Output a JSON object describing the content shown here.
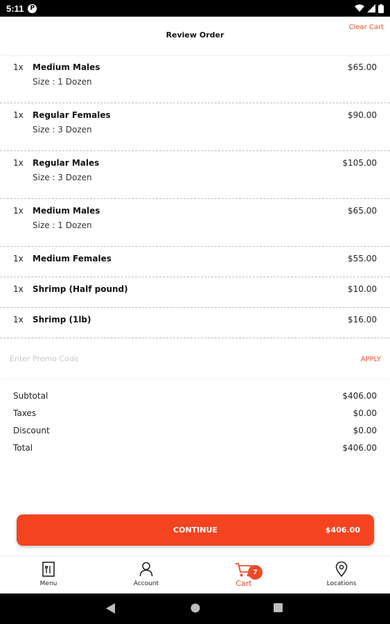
{
  "status_bar": {
    "time": "5:11",
    "notif": "P"
  },
  "header": {
    "title": "Review Order",
    "clear_cart": "Clear Cart"
  },
  "items": [
    {
      "qty": "1x",
      "name": "Medium Males",
      "size": "Size : 1 Dozen",
      "price": "$65.00"
    },
    {
      "qty": "1x",
      "name": "Regular Females",
      "size": "Size : 3 Dozen",
      "price": "$90.00"
    },
    {
      "qty": "1x",
      "name": "Regular Males",
      "size": "Size : 3 Dozen",
      "price": "$105.00"
    },
    {
      "qty": "1x",
      "name": "Medium Males",
      "size": "Size : 1 Dozen",
      "price": "$65.00"
    },
    {
      "qty": "1x",
      "name": "Medium Females",
      "price": "$55.00"
    },
    {
      "qty": "1x",
      "name": "Shrimp (Half pound)",
      "price": "$10.00"
    },
    {
      "qty": "1x",
      "name": "Shrimp (1lb)",
      "price": "$16.00"
    }
  ],
  "promo": {
    "placeholder": "Enter Promo Code",
    "apply": "APPLY"
  },
  "summary": {
    "subtotal_label": "Subtotal",
    "subtotal": "$406.00",
    "taxes_label": "Taxes",
    "taxes": "$0.00",
    "discount_label": "Discount",
    "discount": "$0.00",
    "total_label": "Total",
    "total": "$406.00"
  },
  "continue": {
    "label": "CONTINUE",
    "total": "$406.00"
  },
  "nav": {
    "menu": "Menu",
    "account": "Account",
    "cart": "Cart",
    "cart_count": "7",
    "locations": "Locations"
  },
  "colors": {
    "accent": "#f4431f",
    "text": "#1a1a1a"
  }
}
